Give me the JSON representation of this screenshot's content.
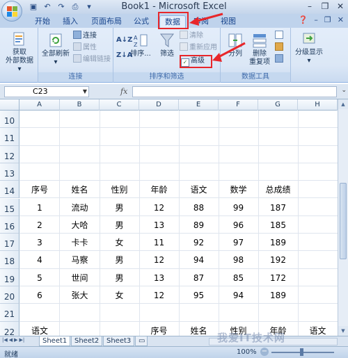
{
  "window": {
    "title": "Book1 - Microsoft Excel",
    "minimize": "–",
    "restore": "❐",
    "close": "✕"
  },
  "quick_access": [
    "save-icon",
    "undo-icon",
    "redo-icon",
    "print-preview-icon",
    "customize-icon"
  ],
  "tabs": [
    {
      "label": "开始"
    },
    {
      "label": "插入"
    },
    {
      "label": "页面布局"
    },
    {
      "label": "公式"
    },
    {
      "label": "数据",
      "active": true
    },
    {
      "label": "审阅"
    },
    {
      "label": "视图"
    }
  ],
  "ribbon": {
    "get_external": {
      "label1": "获取",
      "label2": "外部数据",
      "arrow": "▾"
    },
    "connections": {
      "refresh_all": "全部刷新",
      "connections": "连接",
      "properties": "属性",
      "edit_links": "编辑链接",
      "group_label": "连接"
    },
    "sort_filter": {
      "sort": "排序...",
      "filter": "筛选",
      "clear": "清除",
      "reapply": "重新应用",
      "advanced": "高级",
      "group_label": "排序和筛选"
    },
    "data_tools": {
      "text_to_columns": "分列",
      "remove_duplicates_1": "删除",
      "remove_duplicates_2": "重复项",
      "group_label": "数据工具"
    },
    "outline": {
      "label": "分级显示"
    }
  },
  "formula_bar": {
    "name_box": "C23",
    "fx": "fx",
    "formula": ""
  },
  "columns": [
    "A",
    "B",
    "C",
    "D",
    "E",
    "F",
    "G",
    "H"
  ],
  "rows": [
    {
      "n": "10",
      "cells": [
        "",
        "",
        "",
        "",
        "",
        "",
        "",
        ""
      ]
    },
    {
      "n": "11",
      "cells": [
        "",
        "",
        "",
        "",
        "",
        "",
        "",
        ""
      ]
    },
    {
      "n": "12",
      "cells": [
        "",
        "",
        "",
        "",
        "",
        "",
        "",
        ""
      ]
    },
    {
      "n": "13",
      "cells": [
        "",
        "",
        "",
        "",
        "",
        "",
        "",
        ""
      ]
    },
    {
      "n": "14",
      "cells": [
        "序号",
        "姓名",
        "性别",
        "年龄",
        "语文",
        "数学",
        "总成绩",
        ""
      ]
    },
    {
      "n": "15",
      "cells": [
        "1",
        "流动",
        "男",
        "12",
        "88",
        "99",
        "187",
        ""
      ]
    },
    {
      "n": "16",
      "cells": [
        "2",
        "大哈",
        "男",
        "13",
        "89",
        "96",
        "185",
        ""
      ]
    },
    {
      "n": "17",
      "cells": [
        "3",
        "卡卡",
        "女",
        "11",
        "92",
        "97",
        "189",
        ""
      ]
    },
    {
      "n": "18",
      "cells": [
        "4",
        "马察",
        "男",
        "12",
        "94",
        "98",
        "192",
        ""
      ]
    },
    {
      "n": "19",
      "cells": [
        "5",
        "世间",
        "男",
        "13",
        "87",
        "85",
        "172",
        ""
      ]
    },
    {
      "n": "20",
      "cells": [
        "6",
        "张大",
        "女",
        "12",
        "95",
        "94",
        "189",
        ""
      ]
    },
    {
      "n": "21",
      "cells": [
        "",
        "",
        "",
        "",
        "",
        "",
        "",
        ""
      ]
    },
    {
      "n": "22",
      "cells": [
        "语文",
        "",
        "",
        "序号",
        "姓名",
        "性别",
        "年龄",
        "语文"
      ]
    }
  ],
  "sheets": [
    {
      "label": "Sheet1",
      "active": true
    },
    {
      "label": "Sheet2"
    },
    {
      "label": "Sheet3"
    }
  ],
  "status": {
    "ready": "就绪",
    "zoom": "100%",
    "zoom_level": 1.0
  },
  "watermark": "我爱IT技术网",
  "colors": {
    "highlight_red": "#e8262a",
    "ribbon_blue": "#dbe7f6",
    "tab_bar": "#bfd3ec"
  }
}
